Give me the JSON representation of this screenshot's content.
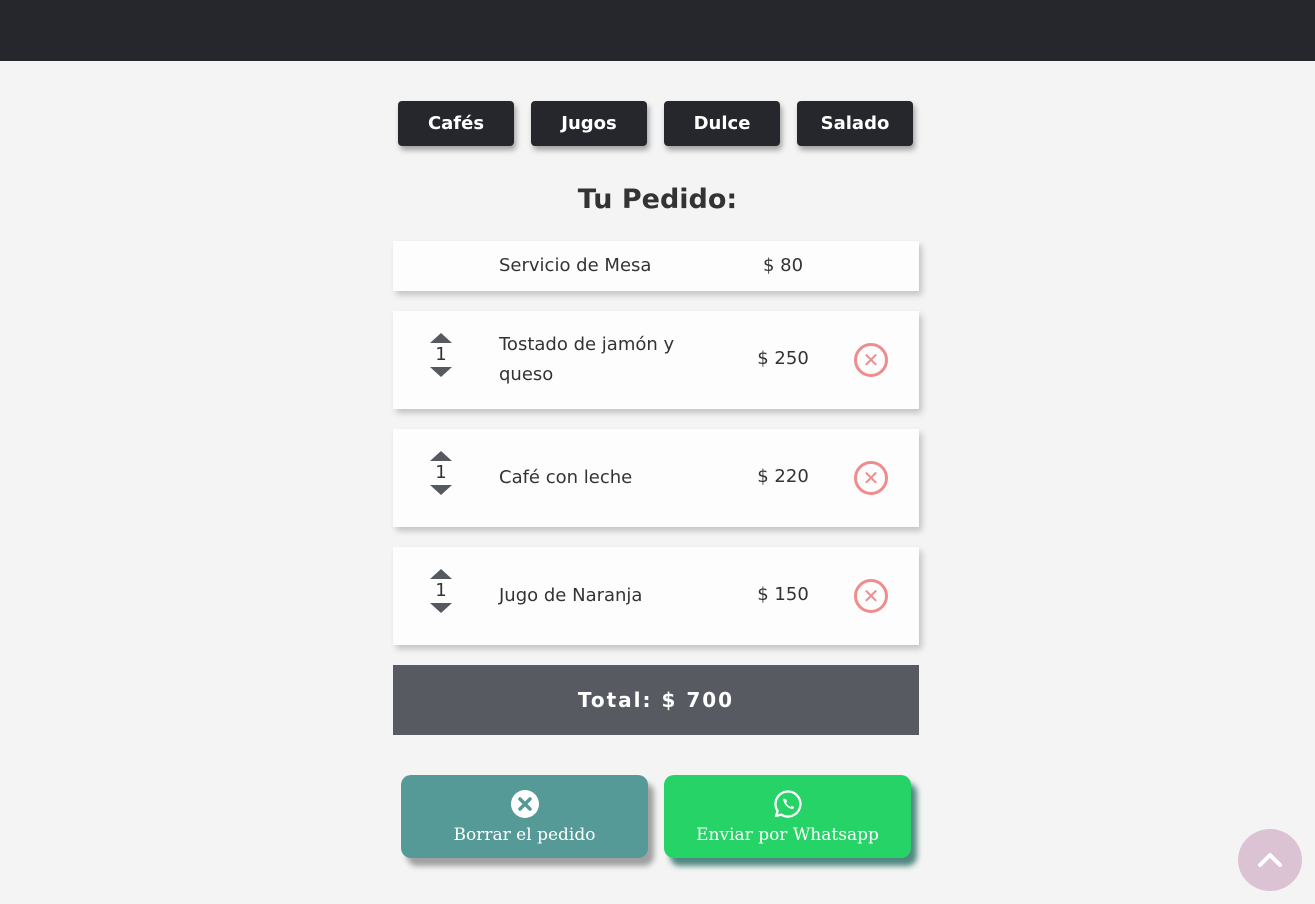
{
  "categories": [
    "Cafés",
    "Jugos",
    "Dulce",
    "Salado"
  ],
  "order": {
    "title": "Tu Pedido:",
    "service": {
      "name": "Servicio de Mesa",
      "price": "$ 80"
    },
    "items": [
      {
        "name": "Tostado de jamón y queso",
        "price": "$ 250",
        "qty": "1"
      },
      {
        "name": "Café con leche",
        "price": "$ 220",
        "qty": "1"
      },
      {
        "name": "Jugo de Naranja",
        "price": "$ 150",
        "qty": "1"
      }
    ],
    "total": "Total: $ 700"
  },
  "actions": {
    "clear_label": "Borrar el pedido",
    "send_label": "Enviar por Whatsapp"
  },
  "icons": {
    "increase": "arrow-up-icon",
    "decrease": "arrow-down-icon",
    "remove": "close-circle-icon",
    "clear": "close-circle-icon",
    "send": "whatsapp-icon",
    "scroll_top": "chevron-up-icon"
  },
  "colors": {
    "topbar": "#26272d",
    "category_button": "#26272d",
    "remove_icon": "#ef8c8d",
    "total_bar": "#575a60",
    "clear_button": "#569a98",
    "send_button": "#25d366",
    "scroll_top": "#dcc3d3"
  }
}
